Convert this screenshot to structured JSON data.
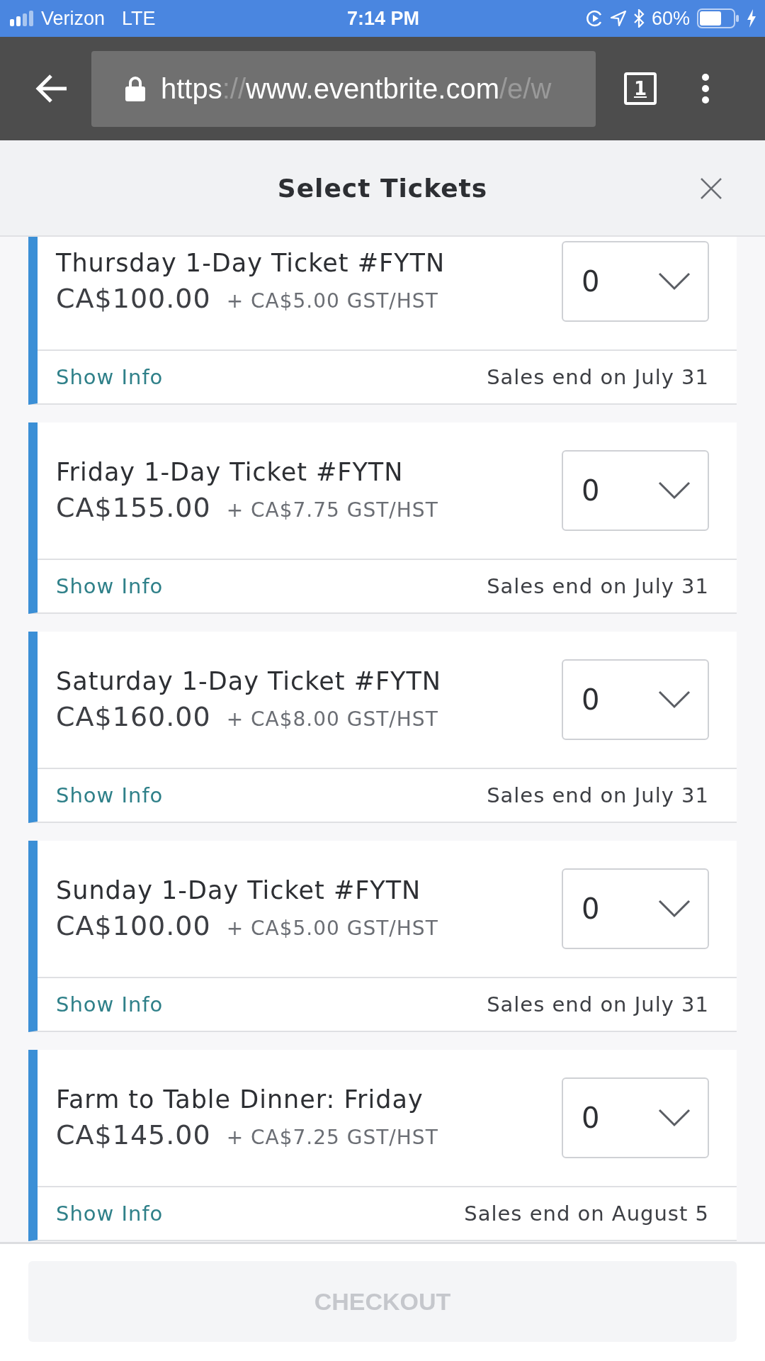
{
  "status_bar": {
    "carrier": "Verizon",
    "network": "LTE",
    "time": "7:14 PM",
    "battery": "60%"
  },
  "browser": {
    "url": [
      {
        "text": "https",
        "kind": "main"
      },
      {
        "text": "://",
        "kind": "dim"
      },
      {
        "text": "www.eventbrite.com",
        "kind": "main"
      },
      {
        "text": "/e/w",
        "kind": "dim"
      }
    ],
    "tab_count": "1"
  },
  "header": {
    "title": "Select Tickets"
  },
  "tickets": [
    {
      "name": "Thursday 1-Day Ticket #FYTN",
      "price": "CA$100.00",
      "tax": "+ CA$5.00 GST/HST",
      "quantity": "0",
      "info_link": "Show Info",
      "sales_end": "Sales end on July 31"
    },
    {
      "name": "Friday 1-Day Ticket #FYTN",
      "price": "CA$155.00",
      "tax": "+ CA$7.75 GST/HST",
      "quantity": "0",
      "info_link": "Show Info",
      "sales_end": "Sales end on July 31"
    },
    {
      "name": "Saturday 1-Day Ticket #FYTN",
      "price": "CA$160.00",
      "tax": "+ CA$8.00 GST/HST",
      "quantity": "0",
      "info_link": "Show Info",
      "sales_end": "Sales end on July 31"
    },
    {
      "name": "Sunday 1-Day Ticket #FYTN",
      "price": "CA$100.00",
      "tax": "+ CA$5.00 GST/HST",
      "quantity": "0",
      "info_link": "Show Info",
      "sales_end": "Sales end on July 31"
    },
    {
      "name": "Farm to Table Dinner: Friday",
      "price": "CA$145.00",
      "tax": "+ CA$7.25 GST/HST",
      "quantity": "0",
      "info_link": "Show Info",
      "sales_end": "Sales end on August 5"
    }
  ],
  "checkout": {
    "label": "CHECKOUT",
    "disabled": true
  }
}
